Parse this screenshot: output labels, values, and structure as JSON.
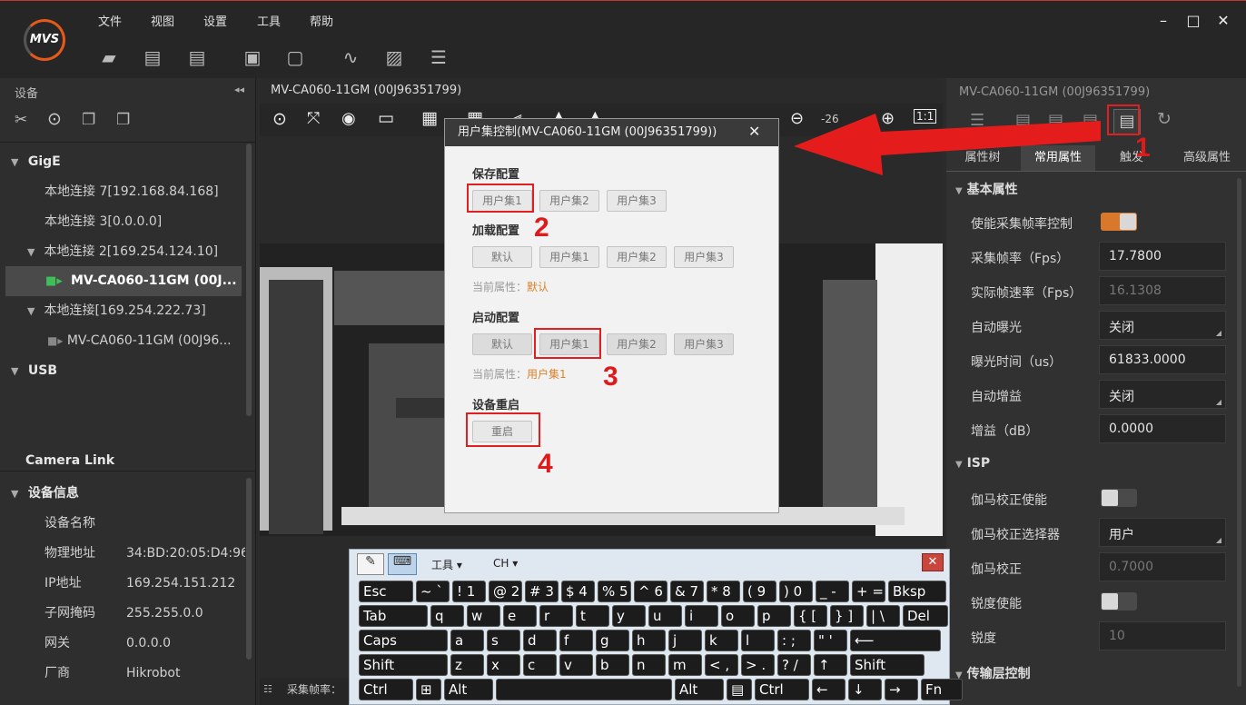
{
  "menu": [
    "文件",
    "视图",
    "设置",
    "工具",
    "帮助"
  ],
  "logo": "MVS",
  "left": {
    "header": "设备",
    "tree": [
      {
        "label": "GigE",
        "type": "section"
      },
      {
        "label": "本地连接 7[192.168.84.168]",
        "type": "item"
      },
      {
        "label": "本地连接 3[0.0.0.0]",
        "type": "item"
      },
      {
        "label": "本地连接 2[169.254.124.10]",
        "type": "group"
      },
      {
        "label": "MV-CA060-11GM (00J...",
        "type": "camera-selected"
      },
      {
        "label": "本地连接[169.254.222.73]",
        "type": "group"
      },
      {
        "label": "MV-CA060-11GM (00J96...",
        "type": "camera"
      },
      {
        "label": "USB",
        "type": "section"
      }
    ],
    "cameralink": "Camera Link",
    "info_header": "设备信息",
    "info": [
      {
        "k": "设备名称",
        "v": ""
      },
      {
        "k": "物理地址",
        "v": "34:BD:20:05:D4:96"
      },
      {
        "k": "IP地址",
        "v": "169.254.151.212"
      },
      {
        "k": "子网掩码",
        "v": "255.255.0.0"
      },
      {
        "k": "网关",
        "v": "0.0.0.0"
      },
      {
        "k": "厂商",
        "v": "Hikrobot"
      }
    ]
  },
  "center": {
    "tab": "MV-CA060-11GM (00J96351799)",
    "zoom": "-26",
    "status": "采集帧率："
  },
  "right": {
    "title": "MV-CA060-11GM (00J96351799)",
    "tabs": [
      "属性树",
      "常用属性",
      "触发",
      "高级属性"
    ],
    "basic_header": "基本属性",
    "props": [
      {
        "label": "使能采集帧率控制",
        "kind": "toggle",
        "on": true
      },
      {
        "label": "采集帧率（Fps）",
        "kind": "value",
        "value": "17.7800"
      },
      {
        "label": "实际帧速率（Fps）",
        "kind": "dim",
        "value": "16.1308"
      },
      {
        "label": "自动曝光",
        "kind": "select",
        "value": "关闭"
      },
      {
        "label": "曝光时间（us）",
        "kind": "value",
        "value": "61833.0000"
      },
      {
        "label": "自动增益",
        "kind": "select",
        "value": "关闭"
      },
      {
        "label": "增益（dB）",
        "kind": "value",
        "value": "0.0000"
      }
    ],
    "isp_header": "ISP",
    "isp": [
      {
        "label": "伽马校正使能",
        "kind": "toggle",
        "on": false
      },
      {
        "label": "伽马校正选择器",
        "kind": "select",
        "value": "用户"
      },
      {
        "label": "伽马校正",
        "kind": "dim",
        "value": "0.7000"
      },
      {
        "label": "锐度使能",
        "kind": "toggle",
        "on": false
      },
      {
        "label": "锐度",
        "kind": "dim",
        "value": "10"
      }
    ],
    "transport_header": "传输层控制"
  },
  "dialog": {
    "title": "用户集控制(MV-CA060-11GM (00J96351799))",
    "save_header": "保存配置",
    "save_btns": [
      "用户集1",
      "用户集2",
      "用户集3"
    ],
    "load_header": "加载配置",
    "load_btns": [
      "默认",
      "用户集1",
      "用户集2",
      "用户集3"
    ],
    "current_label": "当前属性：",
    "load_current": "默认",
    "startup_header": "启动配置",
    "startup_btns": [
      "默认",
      "用户集1",
      "用户集2",
      "用户集3"
    ],
    "startup_current": "用户集1",
    "reboot_header": "设备重启",
    "reboot_btn": "重启"
  },
  "annotations": [
    "1",
    "2",
    "3",
    "4"
  ],
  "keyboard": {
    "tools": "工具",
    "lang": "CH",
    "rows": [
      [
        "Esc",
        "~ `",
        "! 1",
        "@ 2",
        "# 3",
        "$ 4",
        "% 5",
        "^ 6",
        "& 7",
        "* 8",
        "( 9",
        ") 0",
        "_ -",
        "+ =",
        "Bksp"
      ],
      [
        "Tab",
        "q",
        "w",
        "e",
        "r",
        "t",
        "y",
        "u",
        "i",
        "o",
        "p",
        "{ [",
        "} ]",
        "| \\",
        "Del"
      ],
      [
        "Caps",
        "a",
        "s",
        "d",
        "f",
        "g",
        "h",
        "j",
        "k",
        "l",
        ": ;",
        "\" '",
        "⟵"
      ],
      [
        "Shift",
        "z",
        "x",
        "c",
        "v",
        "b",
        "n",
        "m",
        "< ,",
        "> .",
        "? /",
        "↑",
        "Shift"
      ],
      [
        "Ctrl",
        "⊞",
        "Alt",
        "",
        "Alt",
        "▤",
        "Ctrl",
        "←",
        "↓",
        "→",
        "Fn"
      ]
    ]
  },
  "colors": {
    "accent": "#e55a1b",
    "red": "#e02020",
    "bg": "#2b2b2b"
  }
}
